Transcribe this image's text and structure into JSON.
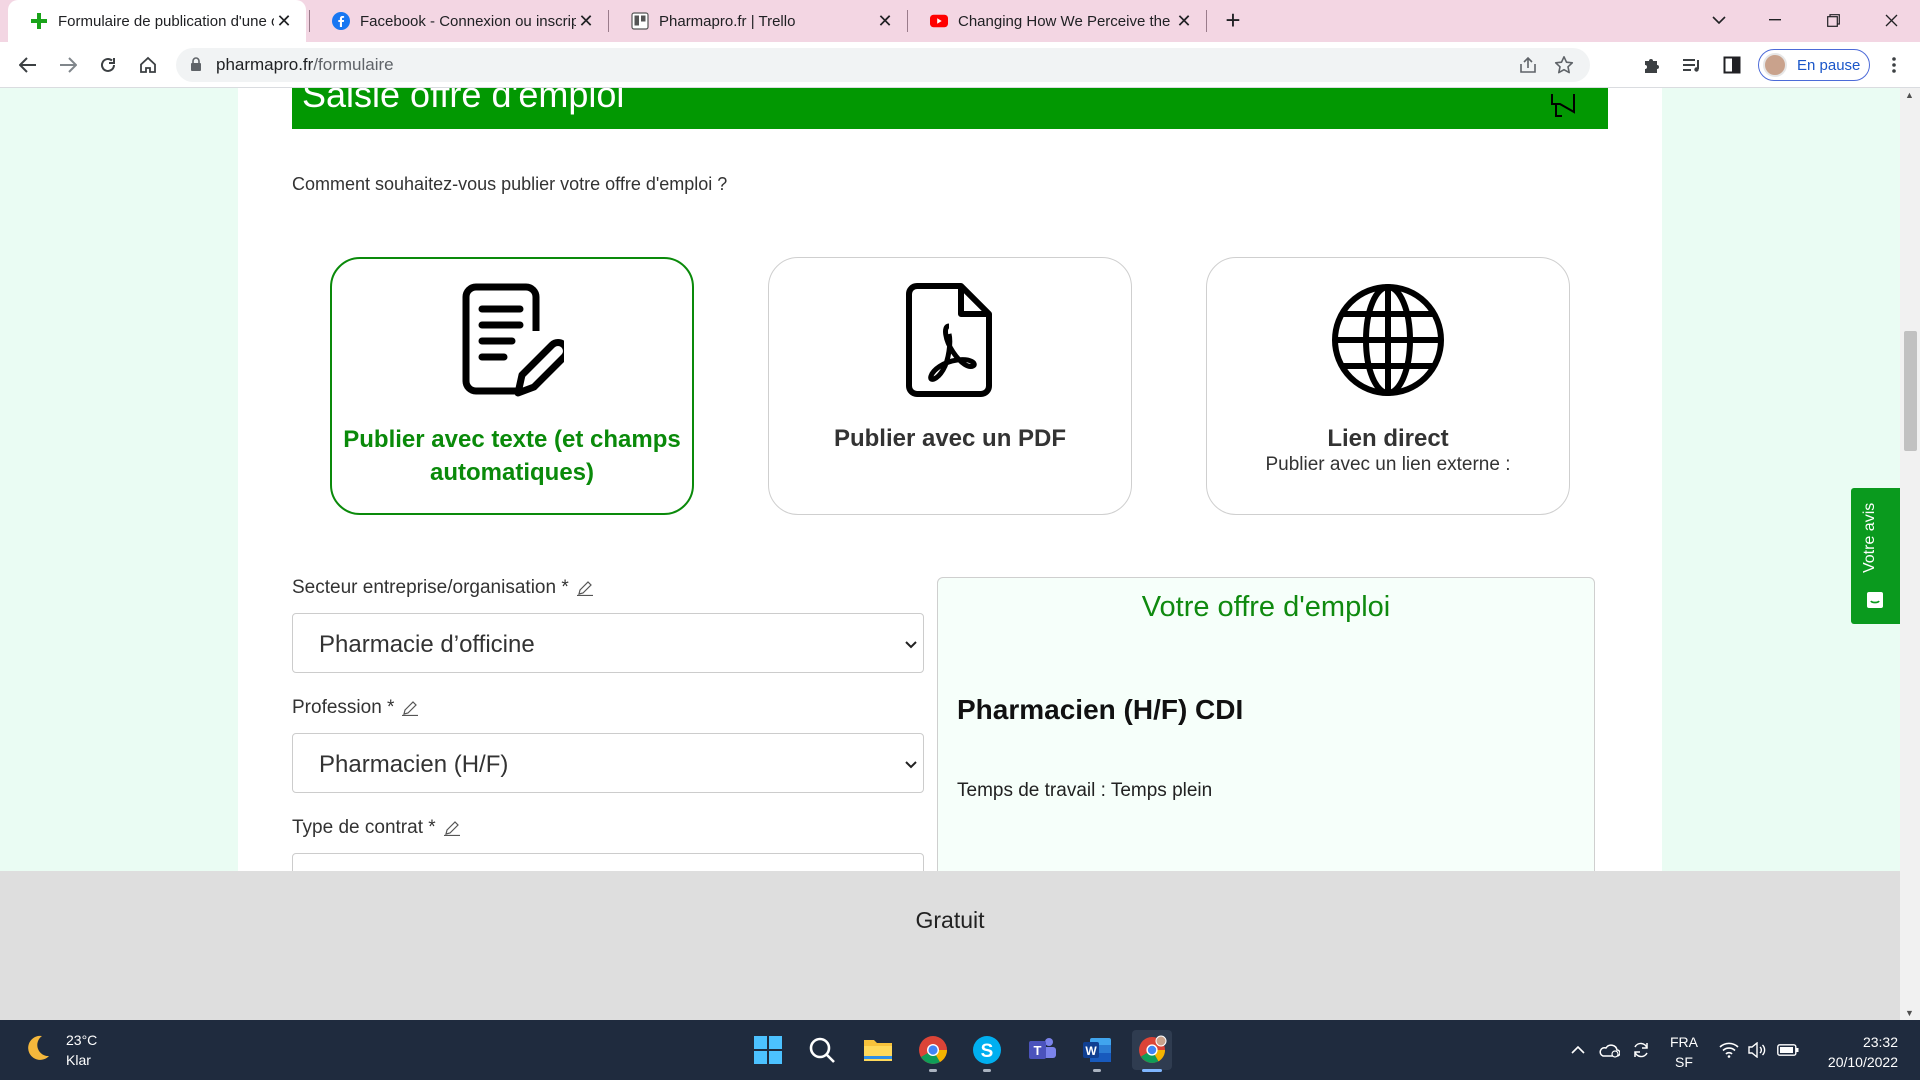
{
  "browser": {
    "tabs": [
      {
        "title": "Formulaire de publication d'une offre",
        "favicon": "pharma-cross-icon",
        "active": true
      },
      {
        "title": "Facebook - Connexion ou inscription",
        "favicon": "facebook-icon",
        "active": false
      },
      {
        "title": "Pharmapro.fr | Trello",
        "favicon": "trello-icon",
        "active": false
      },
      {
        "title": "Changing How We Perceive the World",
        "favicon": "youtube-icon",
        "active": false
      }
    ],
    "new_tab_symbol": "+",
    "url": {
      "host": "pharmapro.fr",
      "path": "/formulaire"
    },
    "profile_label": "En pause",
    "accent_color": "#f3d6e3"
  },
  "page": {
    "header_title": "Saisie offre d'emploi",
    "question": "Comment souhaitez-vous publier votre offre d'emploi ?",
    "cards": [
      {
        "title": "Publier avec texte (et champs automatiques)",
        "subtitle": "",
        "icon": "text-document-edit-icon",
        "selected": true
      },
      {
        "title": "Publier avec un PDF",
        "subtitle": "",
        "icon": "pdf-file-icon",
        "selected": false
      },
      {
        "title": "Lien direct",
        "subtitle": "Publier avec un lien externe :",
        "icon": "globe-icon",
        "selected": false
      }
    ],
    "fields": {
      "sector": {
        "label": "Secteur entreprise/organisation *",
        "value": "Pharmacie d’officine"
      },
      "profession": {
        "label": "Profession *",
        "value": "Pharmacien (H/F)"
      },
      "contract": {
        "label": "Type de contrat *",
        "value": ""
      }
    },
    "preview": {
      "heading": "Votre offre d'emploi",
      "job_title": "Pharmacien (H/F) CDI",
      "work_time": "Temps de travail : Temps plein"
    },
    "footer_text": "Gratuit",
    "feedback_label": "Votre avis",
    "colors": {
      "brand_green": "#029802",
      "selected_green": "#0a8a0a",
      "background_mint": "#eafcf3"
    }
  },
  "taskbar": {
    "weather": {
      "temp": "23°C",
      "condition": "Klar",
      "icon": "moon-icon"
    },
    "apps": [
      "windows-start-icon",
      "search-icon",
      "file-explorer-icon",
      "chrome-icon",
      "skype-icon",
      "teams-icon",
      "word-icon",
      "chrome-profile-icon"
    ],
    "language": {
      "code": "FRA",
      "layout": "SF"
    },
    "time": "23:32",
    "date": "20/10/2022"
  }
}
